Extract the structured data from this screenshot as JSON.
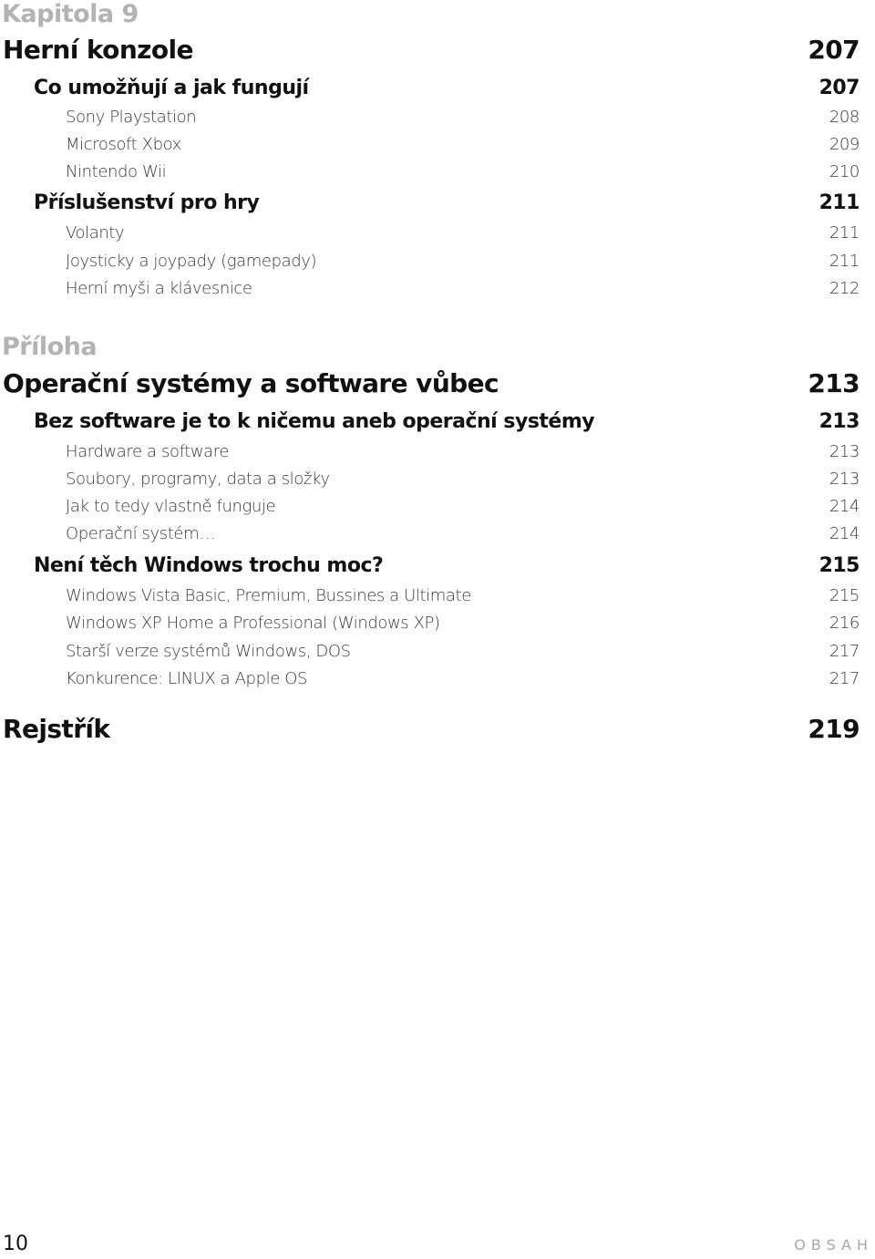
{
  "appendix_label_1": "Kapitola 9",
  "appendix_label_2": "Příloha",
  "toc": {
    "chapter9": {
      "title": "Herní konzole",
      "page": "207",
      "sections": [
        {
          "title": "Co umožňují a jak fungují",
          "page": "207",
          "items": [
            {
              "title": "Sony Playstation",
              "page": "208"
            },
            {
              "title": "Microsoft Xbox",
              "page": "209"
            },
            {
              "title": "Nintendo Wii",
              "page": "210"
            }
          ]
        },
        {
          "title": "Příslušenství pro hry",
          "page": "211",
          "items": [
            {
              "title": "Volanty",
              "page": "211"
            },
            {
              "title": "Joysticky a joypady (gamepady)",
              "page": "211"
            },
            {
              "title": "Herní myši a klávesnice",
              "page": "212"
            }
          ]
        }
      ]
    },
    "appendix": {
      "title": "Operační systémy a software vůbec",
      "page": "213",
      "sections": [
        {
          "title": "Bez software je to k ničemu aneb operační systémy",
          "page": "213",
          "items": [
            {
              "title": "Hardware a software",
              "page": "213"
            },
            {
              "title": "Soubory, programy, data a složky",
              "page": "213"
            },
            {
              "title": "Jak to tedy vlastně funguje",
              "page": "214"
            },
            {
              "title": "Operační systém…",
              "page": "214"
            }
          ]
        },
        {
          "title": "Není těch Windows trochu moc?",
          "page": "215",
          "items": [
            {
              "title": "Windows Vista Basic, Premium, Bussines a Ultimate",
              "page": "215"
            },
            {
              "title": "Windows XP Home a Professional (Windows XP)",
              "page": "216"
            },
            {
              "title": "Starší verze systémů Windows, DOS",
              "page": "217"
            },
            {
              "title": "Konkurence: LINUX a Apple OS",
              "page": "217"
            }
          ]
        }
      ]
    },
    "index": {
      "title": "Rejstřík",
      "page": "219"
    }
  },
  "footer": {
    "page_number": "10",
    "section_label": "OBSAH"
  }
}
